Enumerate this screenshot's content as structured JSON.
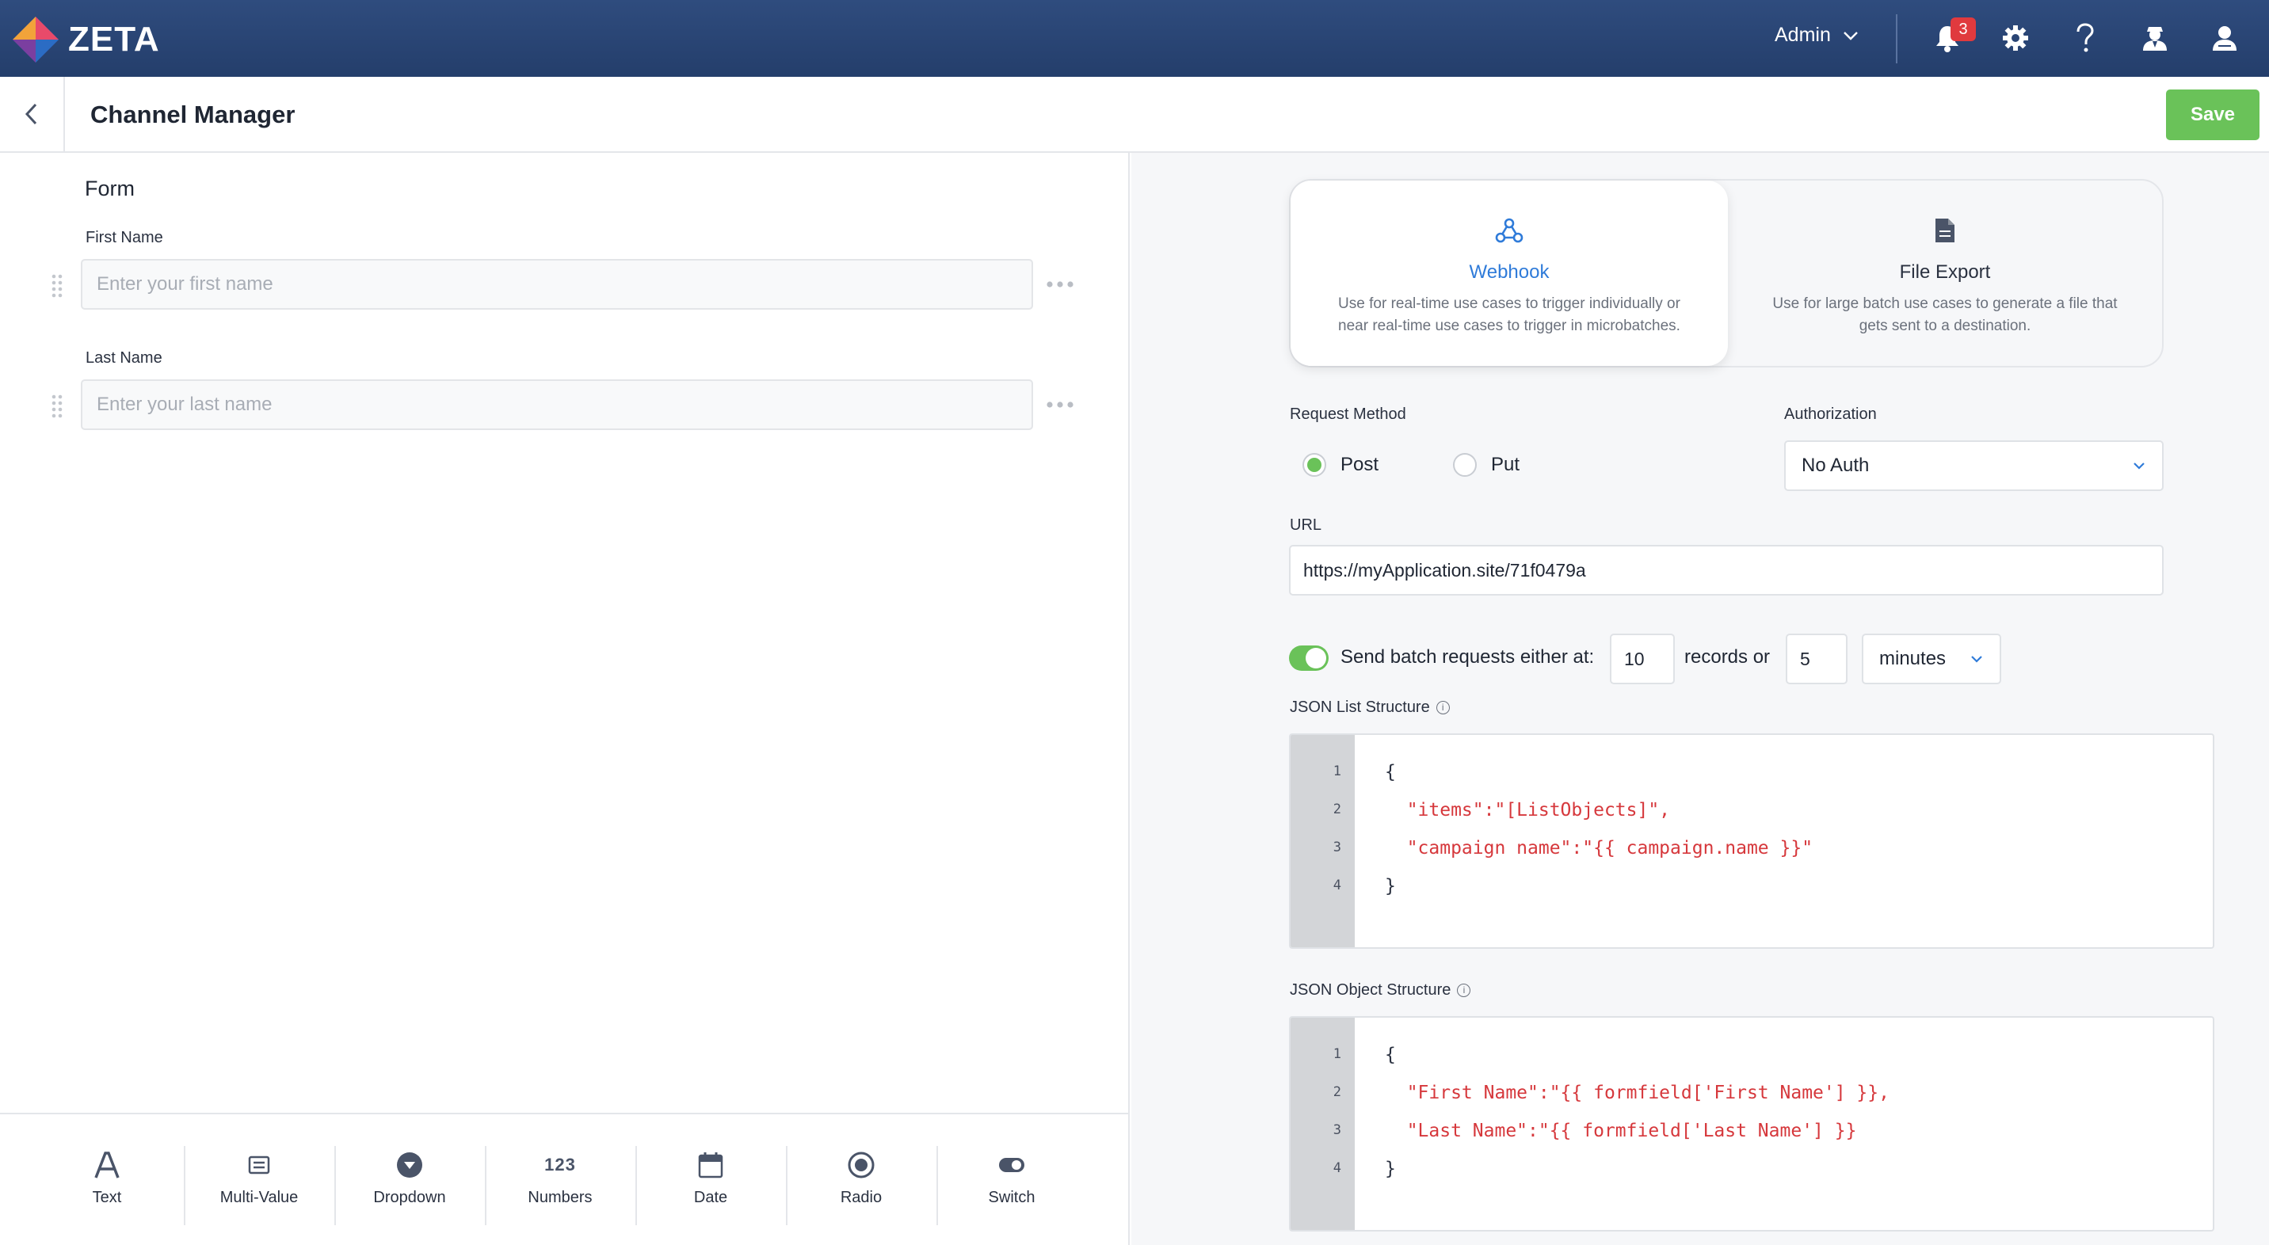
{
  "app": {
    "logo_text": "ZETA"
  },
  "topbar": {
    "user_menu": "Admin",
    "notification_count": "3",
    "icons": [
      "bell-icon",
      "gear-icon",
      "help-icon",
      "agent-icon",
      "user-icon"
    ]
  },
  "header": {
    "title": "Channel Manager",
    "save_label": "Save"
  },
  "form": {
    "title": "Form",
    "fields": [
      {
        "label": "First Name",
        "placeholder": "Enter your first name"
      },
      {
        "label": "Last Name",
        "placeholder": "Enter your last name"
      }
    ],
    "field_types": [
      {
        "label": "Text",
        "icon": "text-icon"
      },
      {
        "label": "Multi-Value",
        "icon": "multi-value-icon"
      },
      {
        "label": "Dropdown",
        "icon": "dropdown-icon"
      },
      {
        "label": "Numbers",
        "icon": "numbers-icon",
        "glyph": "123"
      },
      {
        "label": "Date",
        "icon": "calendar-icon"
      },
      {
        "label": "Radio",
        "icon": "radio-icon"
      },
      {
        "label": "Switch",
        "icon": "switch-icon"
      }
    ]
  },
  "delivery": {
    "options": [
      {
        "title": "Webhook",
        "description": "Use for real-time use cases to trigger individually or near real-time use cases to trigger in microbatches.",
        "selected": true
      },
      {
        "title": "File Export",
        "description": "Use for large batch use cases to generate a file that gets sent to a destination.",
        "selected": false
      }
    ]
  },
  "request": {
    "method_label": "Request Method",
    "methods": [
      {
        "label": "Post",
        "selected": true
      },
      {
        "label": "Put",
        "selected": false
      }
    ],
    "auth_label": "Authorization",
    "auth_value": "No Auth",
    "url_label": "URL",
    "url_value": "https://myApplication.site/71f0479a"
  },
  "batch": {
    "enabled": true,
    "prefix": "Send batch requests either at:",
    "records_value": "10",
    "middle": "records or",
    "time_value": "5",
    "unit": "minutes"
  },
  "json_list": {
    "label": "JSON List Structure",
    "lines": [
      "{",
      "  \"items\":\"[ListObjects]\",",
      "  \"campaign name\":\"{{ campaign.name }}\"",
      "}"
    ]
  },
  "json_object": {
    "label": "JSON Object Structure",
    "lines": [
      "{",
      "  \"First Name\":\"{{ formfield['First Name'] }},",
      "  \"Last Name\":\"{{ formfield['Last Name'] }}",
      "}"
    ]
  },
  "colors": {
    "accent_green": "#6ac259",
    "accent_blue": "#2f7bd9",
    "nav_blue": "#2f4c7e",
    "badge_red": "#e03a3e",
    "code_string": "#d6383c"
  }
}
